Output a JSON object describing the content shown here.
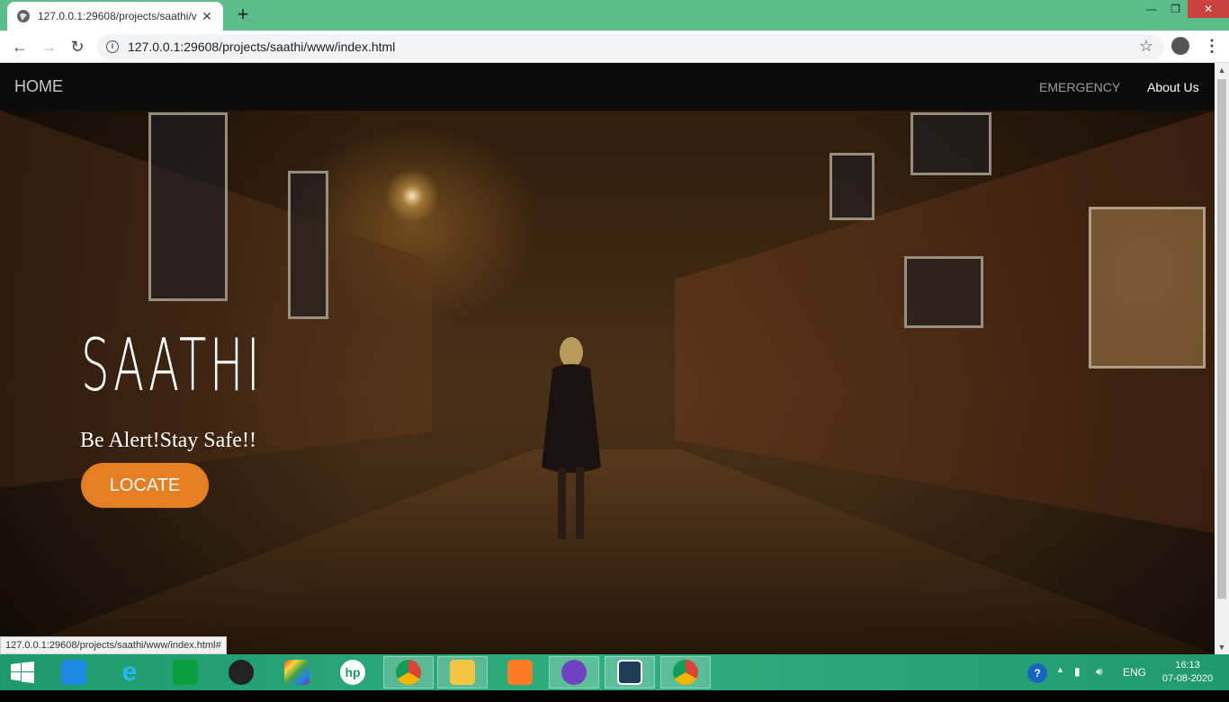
{
  "browser": {
    "tab_title": "127.0.0.1:29608/projects/saathi/v",
    "tab_close": "✕",
    "new_tab": "+",
    "url": "127.0.0.1:29608/projects/saathi/www/index.html",
    "status_url": "127.0.0.1:29608/projects/saathi/www/index.html#"
  },
  "navbar": {
    "brand": "HOME",
    "links": [
      "EMERGENCY",
      "About Us"
    ]
  },
  "hero": {
    "title": "SAATHI",
    "subtitle": "Be Alert!Stay Safe!!",
    "button": "LOCATE"
  },
  "taskbar": {
    "apps": [
      "rocket-app",
      "internet-explorer",
      "windows-store",
      "camera-app",
      "paint-app",
      "hp-app",
      "chrome",
      "file-explorer",
      "xampp",
      "github-desktop",
      "brackets",
      "chrome"
    ],
    "language": "ENG",
    "time": "16:13",
    "date": "07-08-2020"
  },
  "colors": {
    "accent_button": "#e67e22",
    "tabbar": "#5bbd8a",
    "navbar": "#0b0b0c"
  }
}
